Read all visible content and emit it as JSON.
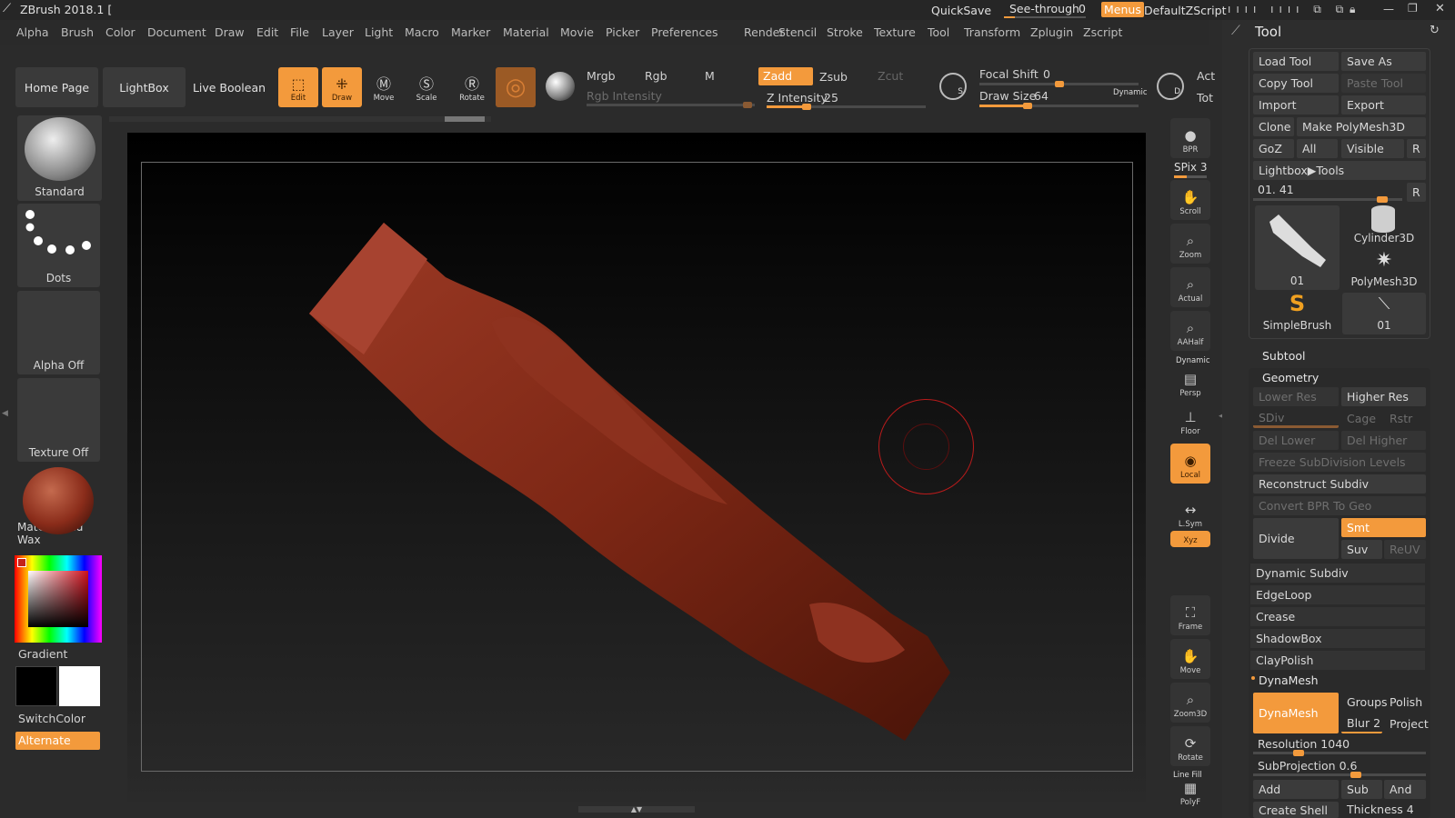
{
  "title_bar": {
    "app_title": "ZBrush 2018.1 [",
    "quicksave": "QuickSave",
    "see_through_label": "See-through",
    "see_through_value": "0",
    "menus": "Menus",
    "script": "DefaultZScript"
  },
  "menu_bar": [
    "Alpha",
    "Brush",
    "Color",
    "Document",
    "Draw",
    "Edit",
    "File",
    "Layer",
    "Light",
    "Macro",
    "Marker",
    "Material",
    "Movie",
    "Picker",
    "Preferences",
    "Render",
    "Stencil",
    "Stroke",
    "Texture",
    "Tool",
    "Transform",
    "Zplugin",
    "Zscript"
  ],
  "top_shelf": {
    "home_page": "Home Page",
    "lightbox": "LightBox",
    "live_boolean": "Live Boolean",
    "edit": "Edit",
    "draw": "Draw",
    "move": "Move",
    "scale": "Scale",
    "rotate": "Rotate",
    "mrgb": "Mrgb",
    "rgb": "Rgb",
    "m": "M",
    "zadd": "Zadd",
    "zsub": "Zsub",
    "zcut": "Zcut",
    "rgb_intensity": "Rgb Intensity",
    "z_intensity_label": "Z Intensity",
    "z_intensity_value": "25",
    "focal_shift_label": "Focal Shift",
    "focal_shift_value": "0",
    "draw_size_label": "Draw Size",
    "draw_size_value": "64",
    "dynamic": "Dynamic",
    "act": "Act",
    "tot": "Tot",
    "z_intensity_level": 0.25,
    "draw_size_level": 0.3,
    "focal_level": 0.5
  },
  "left_shelf": {
    "brush": "Standard",
    "stroke": "Dots",
    "alpha": "Alpha Off",
    "texture": "Texture Off",
    "material": "MatCap Red Wax",
    "gradient": "Gradient",
    "switch_color": "SwitchColor",
    "alternate": "Alternate"
  },
  "right_shelf": [
    {
      "name": "bpr",
      "label": "BPR"
    },
    {
      "name": "scroll",
      "label": "Scroll"
    },
    {
      "name": "zoom",
      "label": "Zoom"
    },
    {
      "name": "actual",
      "label": "Actual"
    },
    {
      "name": "aahalf",
      "label": "AAHalf"
    },
    {
      "name": "persp",
      "label": "Persp"
    },
    {
      "name": "floor",
      "label": "Floor"
    },
    {
      "name": "local",
      "label": "Local"
    },
    {
      "name": "lsym",
      "label": "L.Sym"
    },
    {
      "name": "xyz",
      "label": "Xyz"
    },
    {
      "name": "frame",
      "label": "Frame"
    },
    {
      "name": "move",
      "label": "Move"
    },
    {
      "name": "zoom3d",
      "label": "Zoom3D"
    },
    {
      "name": "rotate",
      "label": "Rotate"
    },
    {
      "name": "polyf",
      "label": "PolyF"
    }
  ],
  "right_shelf_extra": {
    "spix": "SPix 3",
    "dynamic": "Dynamic",
    "line_fill": "Line Fill"
  },
  "tool_panel": {
    "header": "Tool",
    "load_tool": "Load Tool",
    "save_as": "Save As",
    "copy_tool": "Copy Tool",
    "paste_tool": "Paste Tool",
    "import": "Import",
    "export": "Export",
    "clone": "Clone",
    "make_polymesh": "Make PolyMesh3D",
    "goz": "GoZ",
    "all": "All",
    "visible": "Visible",
    "r": "R",
    "lightbox_tools": "Lightbox▶Tools",
    "tool_slider": "01. 41",
    "thumbs": [
      "01",
      "Cylinder3D",
      "PolyMesh3D",
      "SimpleBrush",
      "01"
    ],
    "subtool": "Subtool",
    "geometry": "Geometry",
    "lower_res": "Lower Res",
    "higher_res": "Higher Res",
    "sdiv": "SDiv",
    "cage": "Cage",
    "rstr": "Rstr",
    "del_lower": "Del Lower",
    "del_higher": "Del Higher",
    "freeze": "Freeze SubDivision Levels",
    "reconstruct": "Reconstruct Subdiv",
    "convert_bpr": "Convert BPR To Geo",
    "divide": "Divide",
    "smt": "Smt",
    "suv": "Suv",
    "reuv": "ReUV",
    "dynamic_subdiv": "Dynamic Subdiv",
    "edgeloop": "EdgeLoop",
    "crease": "Crease",
    "shadowbox": "ShadowBox",
    "claypolish": "ClayPolish",
    "dynamesh_section": "DynaMesh",
    "dynamesh_btn": "DynaMesh",
    "groups": "Groups",
    "polish": "Polish",
    "blur": "Blur 2",
    "project": "Project",
    "resolution": "Resolution 1040",
    "subprojection": "SubProjection 0.6",
    "add": "Add",
    "sub": "Sub",
    "and": "And",
    "create_shell": "Create Shell",
    "thickness": "Thickness 4"
  }
}
